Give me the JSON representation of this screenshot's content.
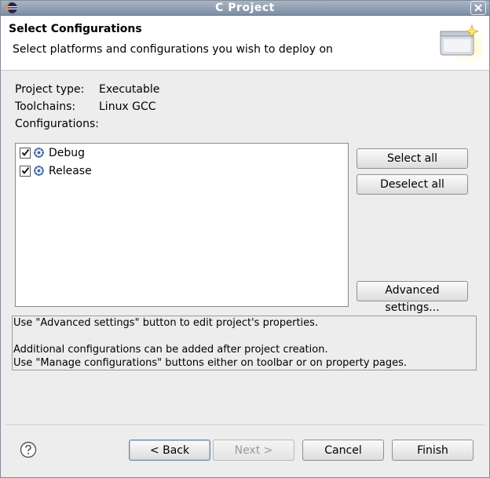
{
  "window": {
    "title": "C Project"
  },
  "header": {
    "title": "Select Configurations",
    "description": "Select platforms and configurations you wish to deploy on"
  },
  "project": {
    "type_label": "Project type:",
    "type_value": "Executable",
    "toolchains_label": "Toolchains:",
    "toolchains_value": "Linux GCC",
    "configurations_label": "Configurations:"
  },
  "configurations": [
    {
      "label": "Debug",
      "checked": true
    },
    {
      "label": "Release",
      "checked": true
    }
  ],
  "side_buttons": {
    "select_all": "Select all",
    "deselect_all": "Deselect all",
    "advanced": "Advanced settings..."
  },
  "info": {
    "line1": "Use \"Advanced settings\" button to edit project's properties.",
    "line2": "Additional configurations can be added after project creation.",
    "line3": "Use \"Manage configurations\" buttons either on toolbar or on property pages."
  },
  "footer": {
    "back": "< Back",
    "next": "Next >",
    "cancel": "Cancel",
    "finish": "Finish"
  },
  "icons": {
    "app": "eclipse-icon",
    "close": "close-icon",
    "wizard": "wizard-banner-icon",
    "config": "configuration-gear-icon",
    "help": "help-icon"
  }
}
